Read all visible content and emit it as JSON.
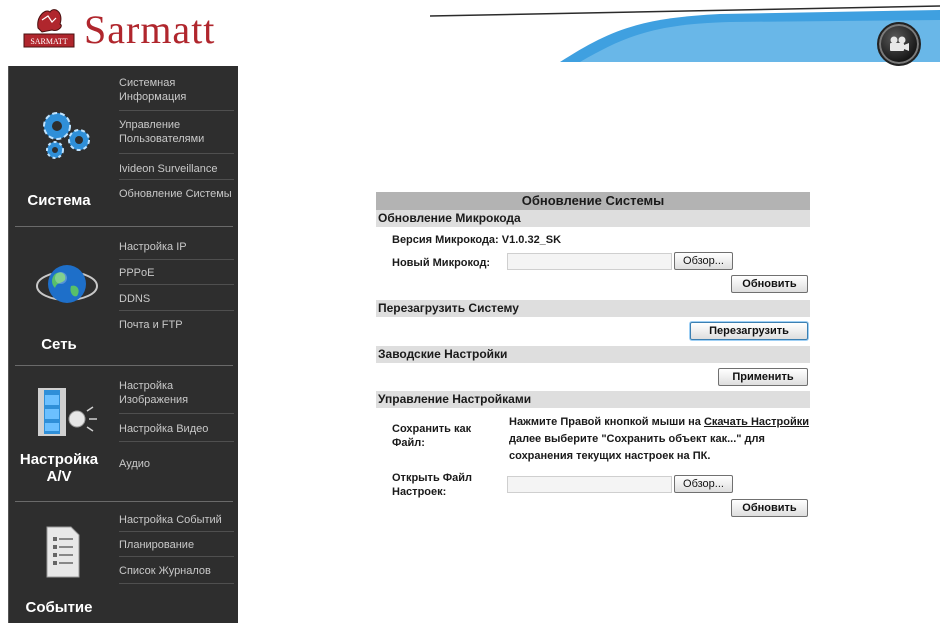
{
  "header": {
    "brand": "Sarmatt",
    "logo_text": "SARMATT",
    "colors": {
      "brand_red": "#b0262d",
      "swoosh_blue": "#3fa0e0"
    },
    "camera_icon": "video-camera-icon"
  },
  "sidebar": {
    "sections": [
      {
        "title": "Система",
        "icon": "gears-icon",
        "items": [
          "Системная Информация",
          "Управление Пользователями",
          "Ivideon Surveillance",
          "Обновление Системы"
        ]
      },
      {
        "title": "Сеть",
        "icon": "globe-icon",
        "items": [
          "Настройка IP",
          "PPPoE",
          "DDNS",
          "Почта и FTP"
        ]
      },
      {
        "title": "Настройка A/V",
        "icon": "film-speaker-icon",
        "items": [
          "Настройка Изображения",
          "Настройка Видео",
          "Аудио"
        ]
      },
      {
        "title": "Событие",
        "icon": "document-list-icon",
        "items": [
          "Настройка Событий",
          "Планирование",
          "Список Журналов"
        ]
      }
    ]
  },
  "main": {
    "title": "Обновление Системы",
    "firmware": {
      "section": "Обновление Микрокода",
      "version_label": "Версия Микрокода:",
      "version_value": "V1.0.32_SK",
      "new_label": "Новый Микрокод:",
      "browse": "Обзор...",
      "update": "Обновить"
    },
    "reboot": {
      "section": "Перезагрузить Систему",
      "button": "Перезагрузить"
    },
    "factory": {
      "section": "Заводские Настройки",
      "button": "Применить"
    },
    "settings": {
      "section": "Управление Настройками",
      "save_label": "Сохранить как Файл:",
      "desc_before": "Нажмите Правой кнопкой мыши на ",
      "desc_link": "Скачать Настройки",
      "desc_after": " далее выберите \"Сохранить объект как...\" для сохранения текущих настроек на ПК.",
      "open_label": "Открыть Файл Настроек:",
      "browse": "Обзор...",
      "update": "Обновить"
    }
  }
}
